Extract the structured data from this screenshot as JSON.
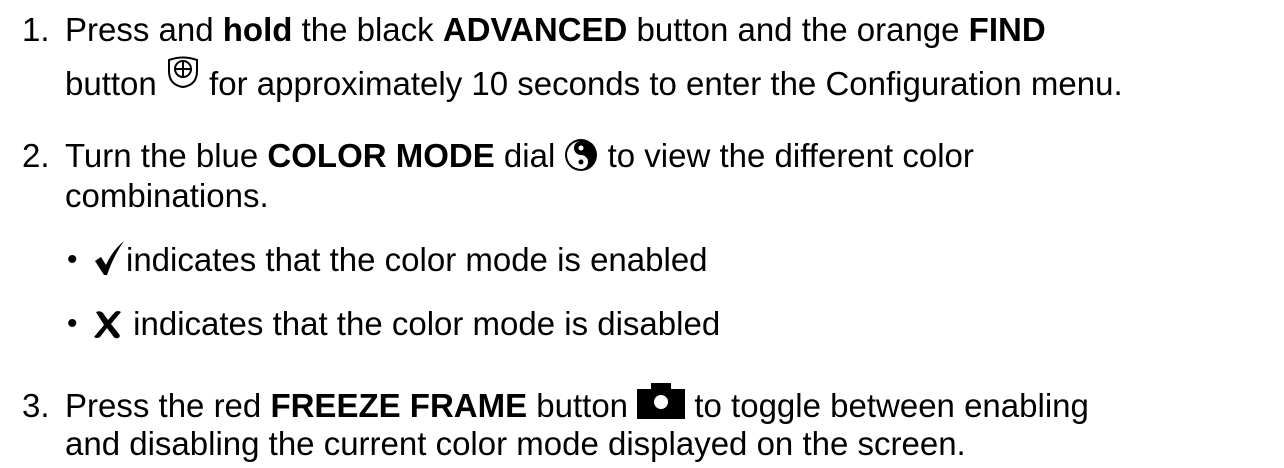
{
  "colors": {
    "text": "#000000",
    "background": "#ffffff"
  },
  "icons": {
    "find": "find-button-icon",
    "color_mode": "color-mode-dial-icon",
    "enabled": "checkmark-icon",
    "disabled": "x-mark-icon",
    "freeze_frame": "camera-icon"
  },
  "steps": [
    {
      "number": "1.",
      "line1": {
        "t1": "Press and ",
        "b1": "hold",
        "t2": " the black ",
        "b2": "ADVANCED",
        "t3": " button and the orange ",
        "b3": "FIND"
      },
      "line2": {
        "t1": "button ",
        "t2": " for approximately 10 seconds to enter the Configuration menu."
      }
    },
    {
      "number": "2.",
      "line1": {
        "t1": "Turn the blue ",
        "b1": "COLOR MODE",
        "t2": " dial ",
        "t3": " to view the different color"
      },
      "line2": {
        "t1": "combinations."
      },
      "bullets": [
        {
          "mark": "•",
          "text": "indicates that the color mode is enabled"
        },
        {
          "mark": "•",
          "text": " indicates that the color mode is disabled"
        }
      ]
    },
    {
      "number": "3.",
      "line1": {
        "t1": "Press the red ",
        "b1": "FREEZE FRAME",
        "t2": " button ",
        "t3": " to toggle between enabling"
      },
      "line2": {
        "t1": "and disabling the current color mode displayed on the screen."
      }
    }
  ]
}
